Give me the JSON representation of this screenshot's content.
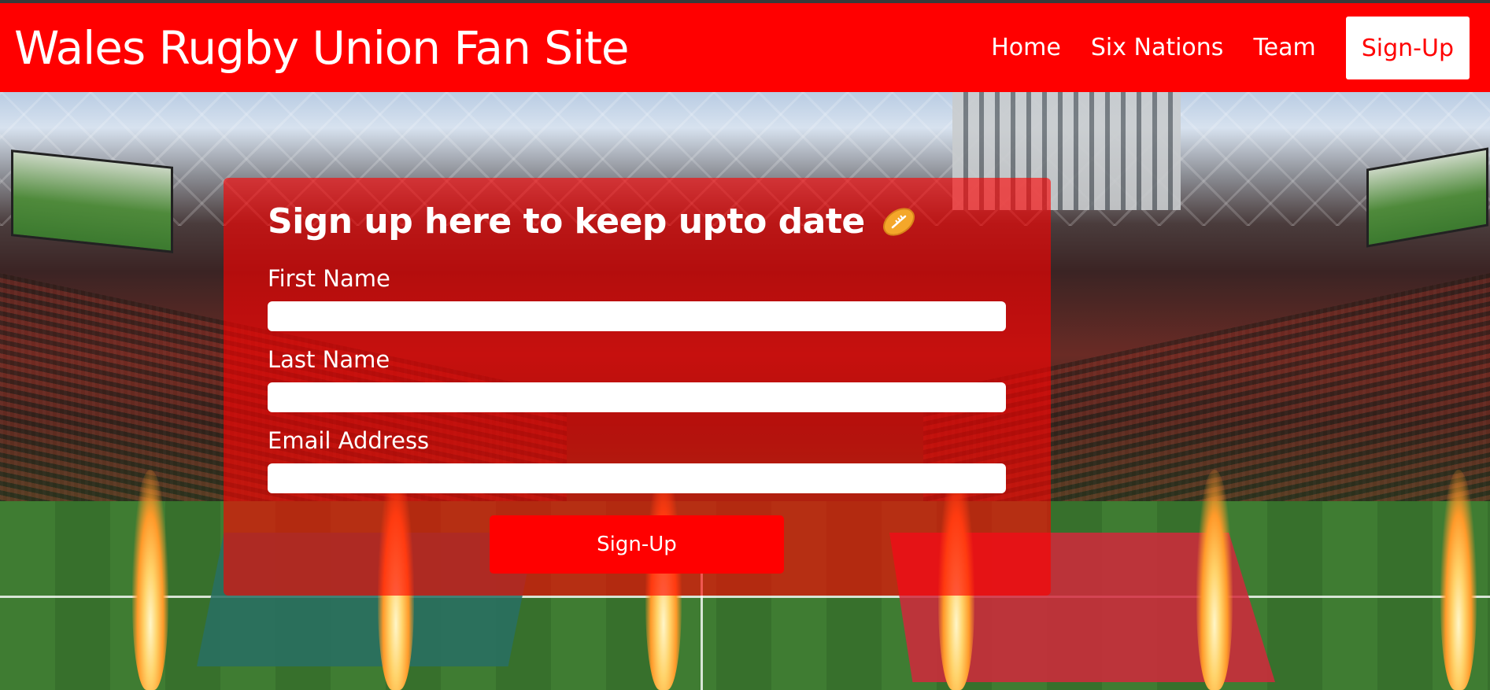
{
  "header": {
    "site_title": "Wales Rugby Union Fan Site",
    "nav": [
      {
        "label": "Home"
      },
      {
        "label": "Six Nations"
      },
      {
        "label": "Team"
      },
      {
        "label": "Sign-Up",
        "active": true
      }
    ]
  },
  "hero": {
    "background_image": "rugby-stadium-photo"
  },
  "form": {
    "title": "Sign up here to keep upto date",
    "title_icon": "rugby-ball-icon",
    "fields": [
      {
        "label": "First Name",
        "value": "",
        "placeholder": ""
      },
      {
        "label": "Last Name",
        "value": "",
        "placeholder": ""
      },
      {
        "label": "Email Address",
        "value": "",
        "placeholder": ""
      }
    ],
    "submit_label": "Sign-Up"
  },
  "colors": {
    "brand_red": "#ff0000",
    "panel_red": "rgba(255,0,0,0.62)",
    "white": "#ffffff"
  }
}
